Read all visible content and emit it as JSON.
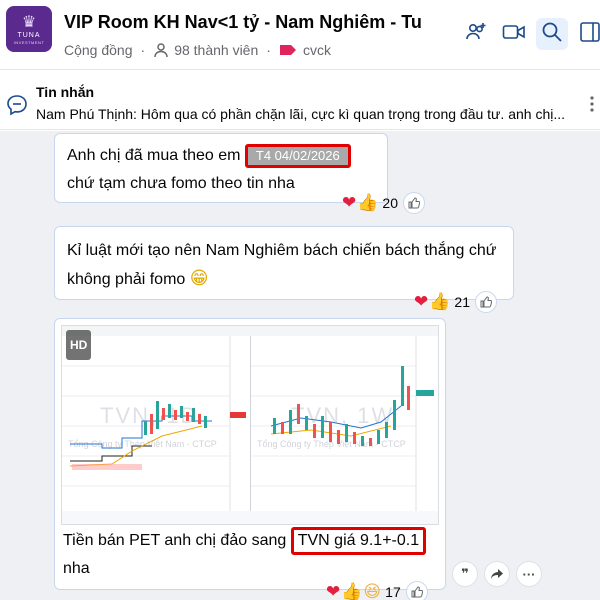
{
  "header": {
    "logo_name": "TUNA",
    "logo_sub": "INVESTMENT",
    "title": "VIP Room KH Nav<1 tỷ - Nam Nghiêm - Tu",
    "community": "Cộng đồng",
    "members": "98 thành viên",
    "tag": "cvck"
  },
  "pinned": {
    "label": "Tin nhắn",
    "text": "Nam Phú Thịnh: Hôm qua có phần chặn lãi, cực kì quan trọng trong đầu tư. anh chị..."
  },
  "messages": [
    {
      "text_before": "Anh chị đã mua theo em",
      "timestamp": "T4 04/02/2026",
      "text_after": "chứ tạm chưa fomo theo tin nha",
      "reactions": {
        "emojis": [
          "heart",
          "thumbs-up"
        ],
        "count": "20"
      }
    },
    {
      "text": "Kỉ luật mới tạo nên Nam Nghiêm bách chiến bách thắng chứ không phải fomo",
      "emoji": "😁",
      "reactions": {
        "emojis": [
          "heart",
          "thumbs-up"
        ],
        "count": "21"
      }
    },
    {
      "image": {
        "badge": "HD",
        "left_chart": {
          "watermark": "TVN, 1D",
          "sub_watermark": "Tổng Công ty Thép Việt Nam - CTCP"
        },
        "right_chart": {
          "watermark": "TVN, 1W",
          "sub_watermark": "Tổng Công ty Thép Việt Nam - CTCP"
        }
      },
      "text_before": "Tiền bán PET anh chị đảo sang",
      "highlight": "TVN giá 9.1+-0.1",
      "text_after": "nha",
      "reactions": {
        "emojis": [
          "heart",
          "thumbs-up",
          "laughing"
        ],
        "count": "17"
      }
    }
  ],
  "colors": {
    "accent": "#0866ff",
    "highlight_border": "#e00000",
    "logo_bg": "#5b2a8e"
  }
}
